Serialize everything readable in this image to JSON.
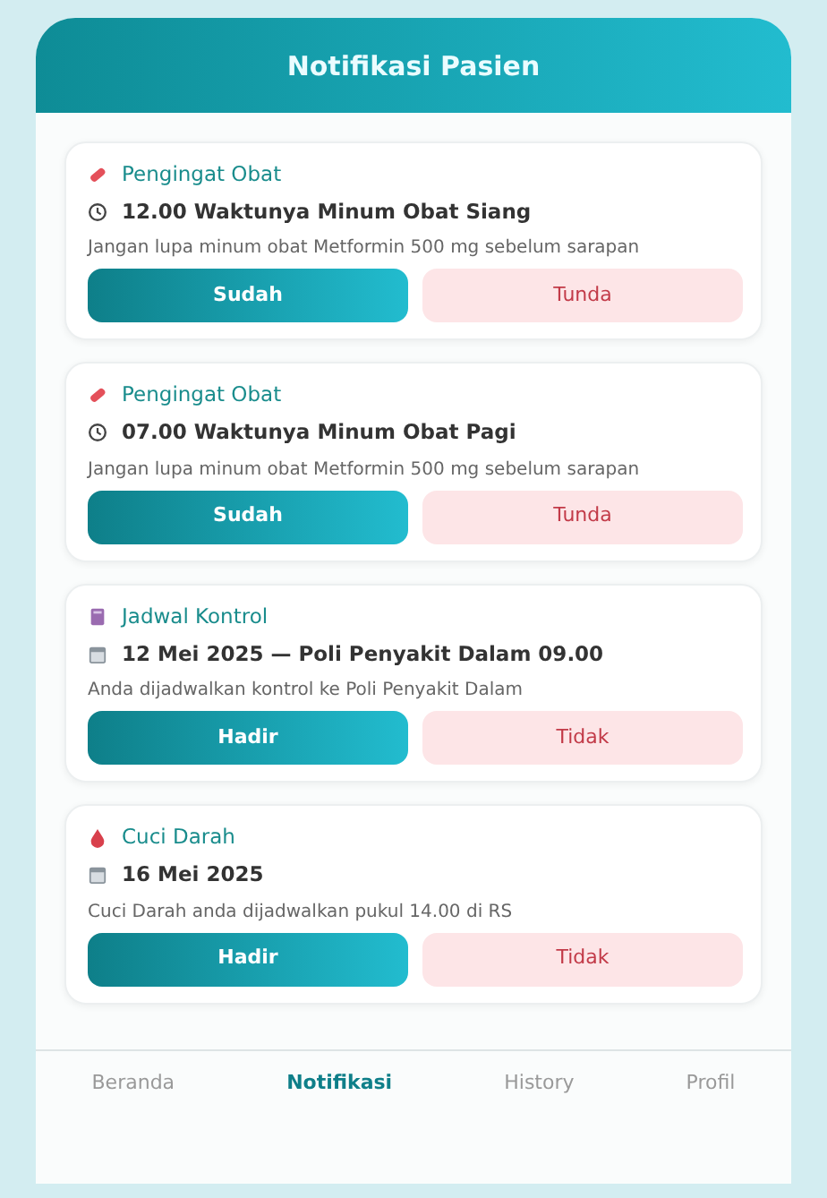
{
  "header": {
    "title": "Notifikasi Pasien"
  },
  "notifications": [
    {
      "kind": "pill",
      "category": "Pengingat Obat",
      "headline": {
        "kind": "clock",
        "text": "12.00 Waktunya Minum Obat Siang"
      },
      "message": "Jangan lupa minum obat Metformin 500 mg sebelum sarapan",
      "actions": [
        "Sudah",
        "Tunda"
      ]
    },
    {
      "kind": "pill",
      "category": "Pengingat Obat",
      "headline": {
        "kind": "clock",
        "text": "07.00 Waktunya Minum Obat Pagi"
      },
      "message": "Jangan lupa minum obat Metformin 500 mg sebelum sarapan",
      "actions": [
        "Sudah",
        "Tunda"
      ]
    },
    {
      "kind": "book",
      "category": "Jadwal Kontrol",
      "headline": {
        "kind": "calendar",
        "text": "12 Mei 2025 — Poli Penyakit Dalam 09.00"
      },
      "message": "Anda dijadwalkan kontrol ke Poli Penyakit Dalam",
      "actions": [
        "Hadir",
        "Tidak"
      ]
    },
    {
      "kind": "drop",
      "category": "Cuci Darah",
      "headline": {
        "kind": "calendar",
        "text": "16 Mei 2025"
      },
      "message": "Cuci Darah anda dijadwalkan pukul 14.00 di RS",
      "actions": [
        "Hadir",
        "Tidak"
      ]
    }
  ],
  "bottom_nav": [
    {
      "label": "Beranda",
      "selected": false
    },
    {
      "label": "Notifikasi",
      "selected": true
    },
    {
      "label": "History",
      "selected": false
    },
    {
      "label": "Profil",
      "selected": false
    }
  ]
}
